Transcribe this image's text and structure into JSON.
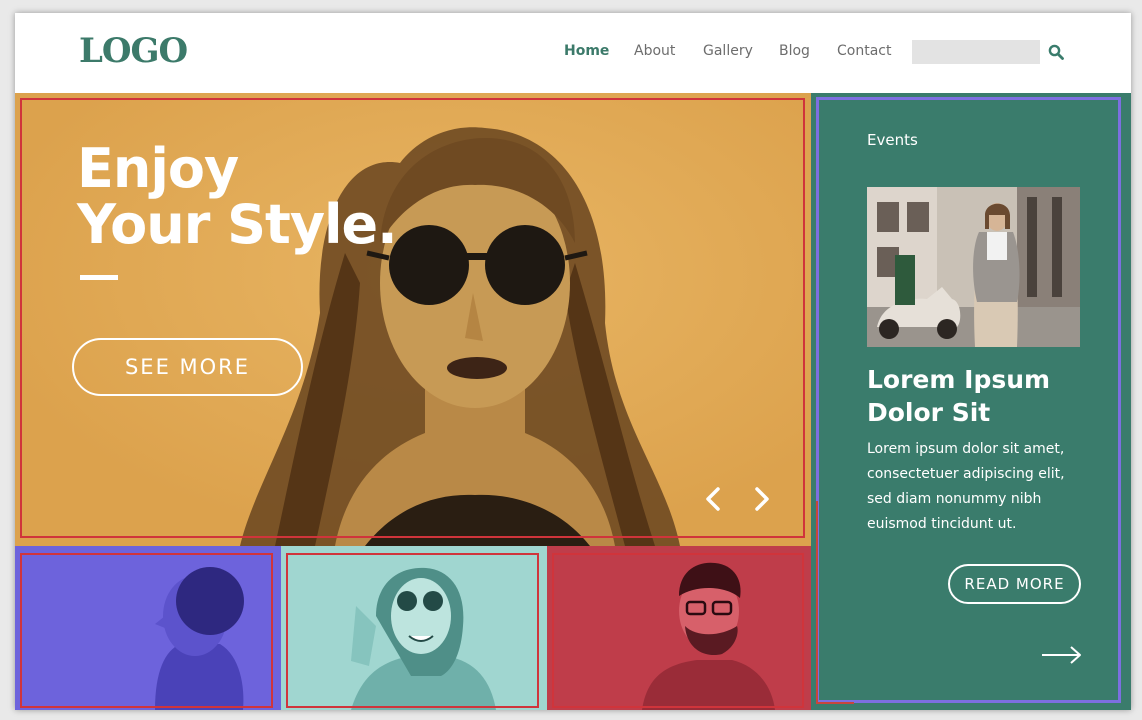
{
  "header": {
    "logo": "LOGO",
    "nav": [
      {
        "label": "Home",
        "active": true
      },
      {
        "label": "About"
      },
      {
        "label": "Gallery"
      },
      {
        "label": "Blog"
      },
      {
        "label": "Contact"
      }
    ],
    "search": {
      "placeholder": "",
      "icon": "search-icon"
    }
  },
  "hero": {
    "title_line1": "Enjoy",
    "title_line2": "Your Style.",
    "cta_label": "SEE MORE",
    "prev_icon": "chevron-left-icon",
    "next_icon": "chevron-right-icon"
  },
  "events": {
    "label": "Events",
    "title_line1": "Lorem Ipsum",
    "title_line2": "Dolor Sit",
    "text": "Lorem ipsum dolor sit amet, consectetuer adipiscing elit, sed diam nonummy nibh euismod tincidunt ut.",
    "read_more_label": "READ MORE",
    "arrow_icon": "arrow-right-icon"
  },
  "colors": {
    "brand_green": "#3a7c6c",
    "hero_yellow": "#e4ad57",
    "tile_purple": "#6f66de",
    "tile_teal": "#9bd3cd",
    "tile_red": "#bf3d4a",
    "outline_red": "#d0343b",
    "outline_purple": "#7d6fe0"
  }
}
